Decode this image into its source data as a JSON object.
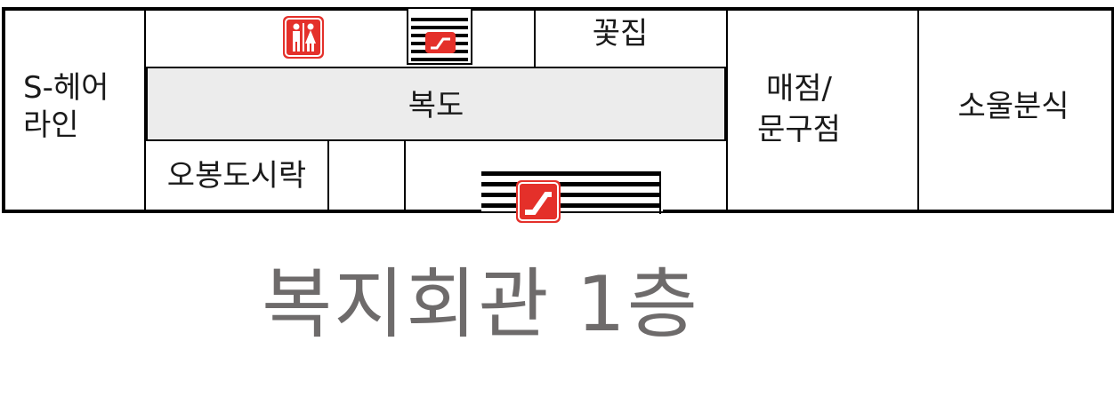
{
  "rooms": {
    "hair_salon": {
      "line1": "S-헤어",
      "line2": "라인"
    },
    "flower_shop": "꽃집",
    "corridor": "복도",
    "store": {
      "line1": "매점/",
      "line2": "문구점"
    },
    "snack_bar": "소울분식",
    "lunchbox": "오봉도시락"
  },
  "title": "복지회관 1층",
  "colors": {
    "icon_red": "#e4302a",
    "corridor_fill": "#ececec",
    "title_gray": "#6e6b6b"
  },
  "icons": [
    "restroom-icon",
    "escalator-icon",
    "escalator-icon"
  ]
}
